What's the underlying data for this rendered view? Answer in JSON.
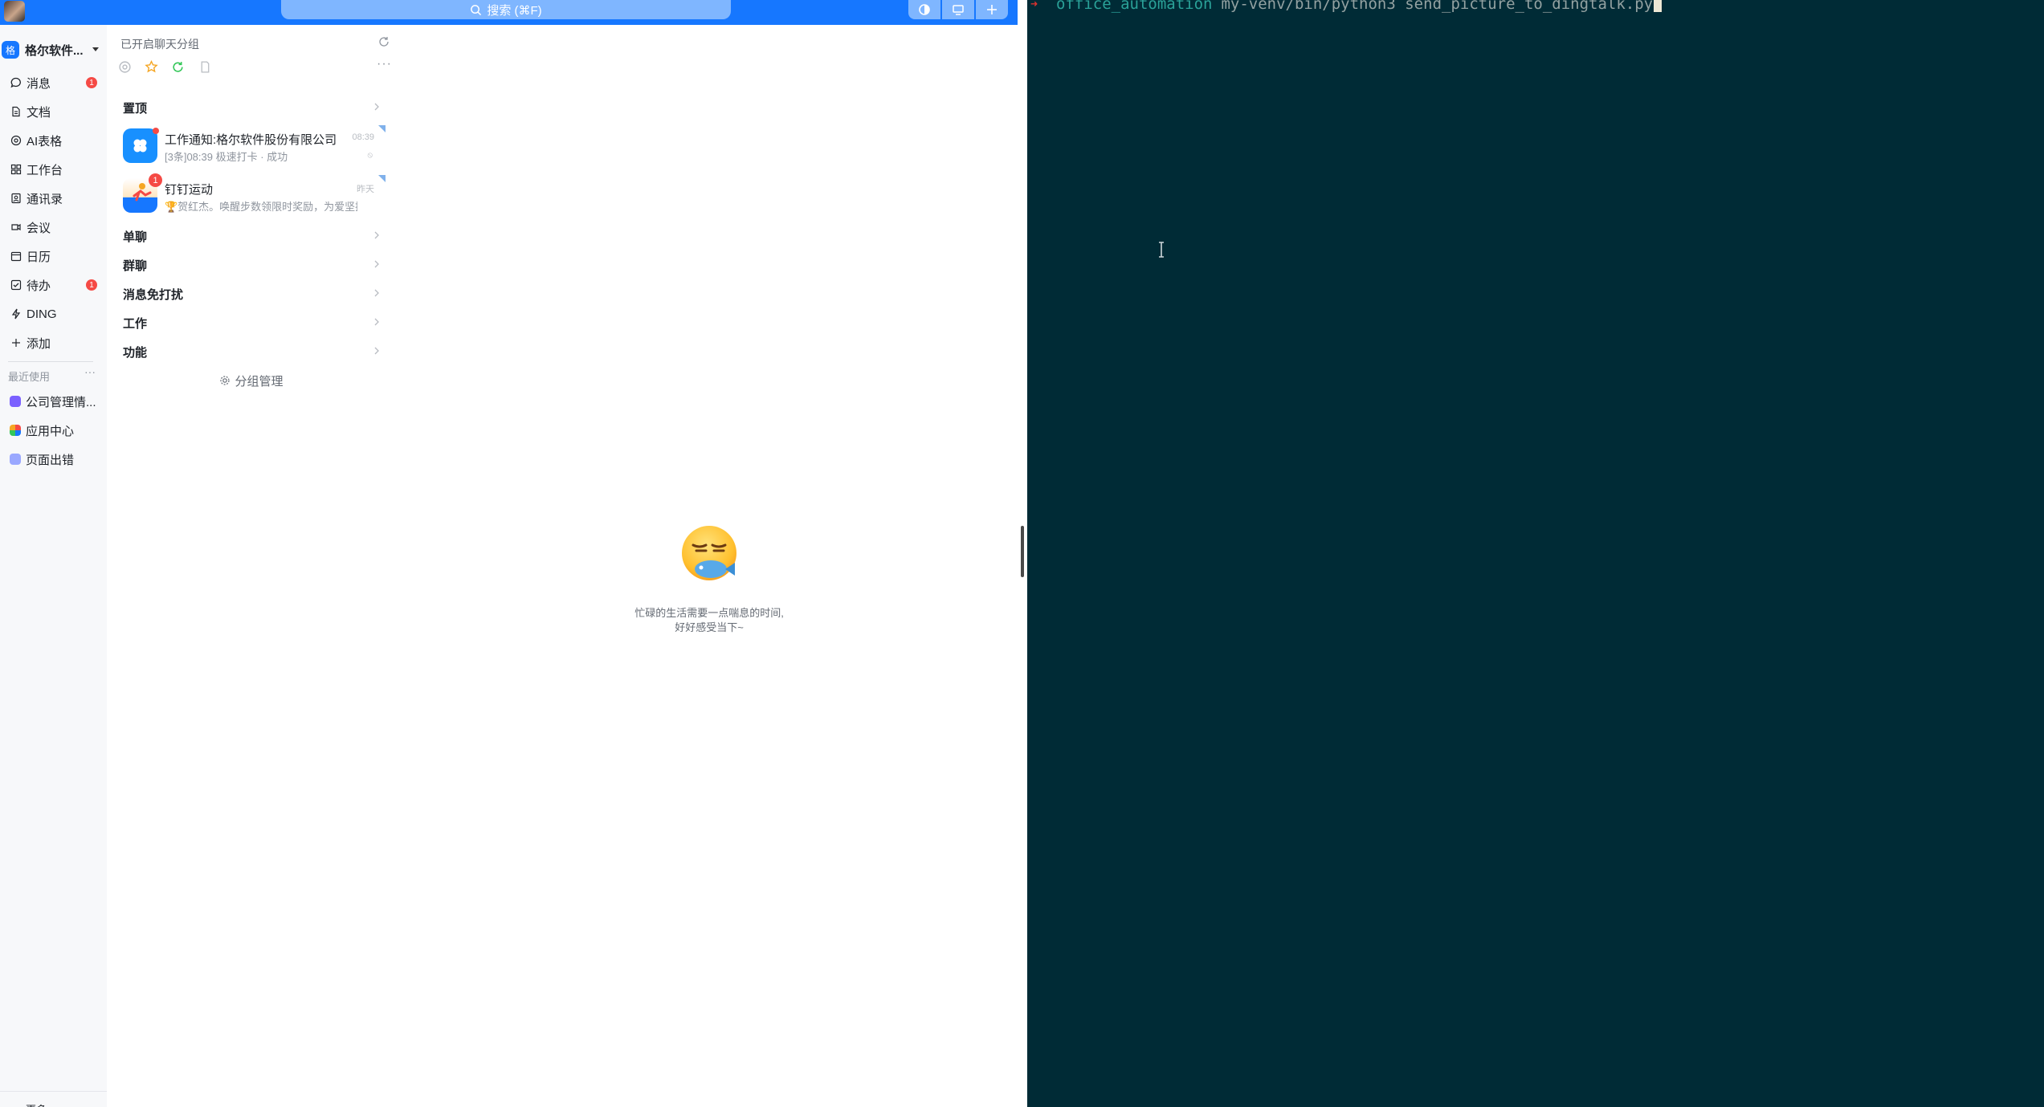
{
  "search": {
    "label": "搜索 (⌘F)"
  },
  "org": {
    "logo_text": "格",
    "name": "格尔软件..."
  },
  "nav": {
    "items": [
      {
        "label": "消息",
        "icon": "chat-icon",
        "badge": "1"
      },
      {
        "label": "文档",
        "icon": "document-icon"
      },
      {
        "label": "AI表格",
        "icon": "ai-table-icon"
      },
      {
        "label": "工作台",
        "icon": "grid-icon"
      },
      {
        "label": "通讯录",
        "icon": "contacts-icon"
      },
      {
        "label": "会议",
        "icon": "meeting-icon"
      },
      {
        "label": "日历",
        "icon": "calendar-icon"
      },
      {
        "label": "待办",
        "icon": "todo-icon",
        "badge": "1"
      },
      {
        "label": "DING",
        "icon": "ding-icon"
      },
      {
        "label": "添加",
        "icon": "plus-icon"
      }
    ],
    "recent_title": "最近使用",
    "recent_more": "···",
    "recent": [
      {
        "label": "公司管理情...",
        "color": "#7b61ff"
      },
      {
        "label": "应用中心",
        "color": "#f5a623"
      },
      {
        "label": "页面出错",
        "color": "#9aa8ff"
      }
    ],
    "bottom_text": "更多"
  },
  "conversations": {
    "group_title": "已开启聊天分组",
    "more": "···",
    "filters": [
      "at-icon",
      "star-icon",
      "refresh-circle-icon",
      "file-icon"
    ],
    "sections": {
      "pinned": "置顶",
      "single": "单聊",
      "group": "群聊",
      "dnd": "消息免打扰",
      "work": "工作",
      "function": "功能"
    },
    "items": [
      {
        "name": "工作通知:格尔软件股份有限公司",
        "preview": "[3条]08:39 极速打卡 · 成功",
        "time": "08:39",
        "mute": "⦸"
      },
      {
        "name": "钉钉运动",
        "preview": "🏆贺红杰。唤醒步数领限时奖励，为爱坚持！",
        "time": "昨天",
        "badge": "1"
      }
    ],
    "manage_label": "分组管理"
  },
  "empty_state": {
    "line1": "忙碌的生活需要一点喘息的时间,",
    "line2": "好好感受当下~"
  },
  "terminal": {
    "prompt_arrow": "➜",
    "directory": "office_automation",
    "command": "my-venv/bin/python3 send_picture_to_dingtalk.py"
  },
  "colors": {
    "accent": "#1677ff",
    "badge": "#f54a45",
    "terminal_bg": "#002b36",
    "terminal_dir": "#2aa198",
    "terminal_text": "#93a1a1"
  }
}
